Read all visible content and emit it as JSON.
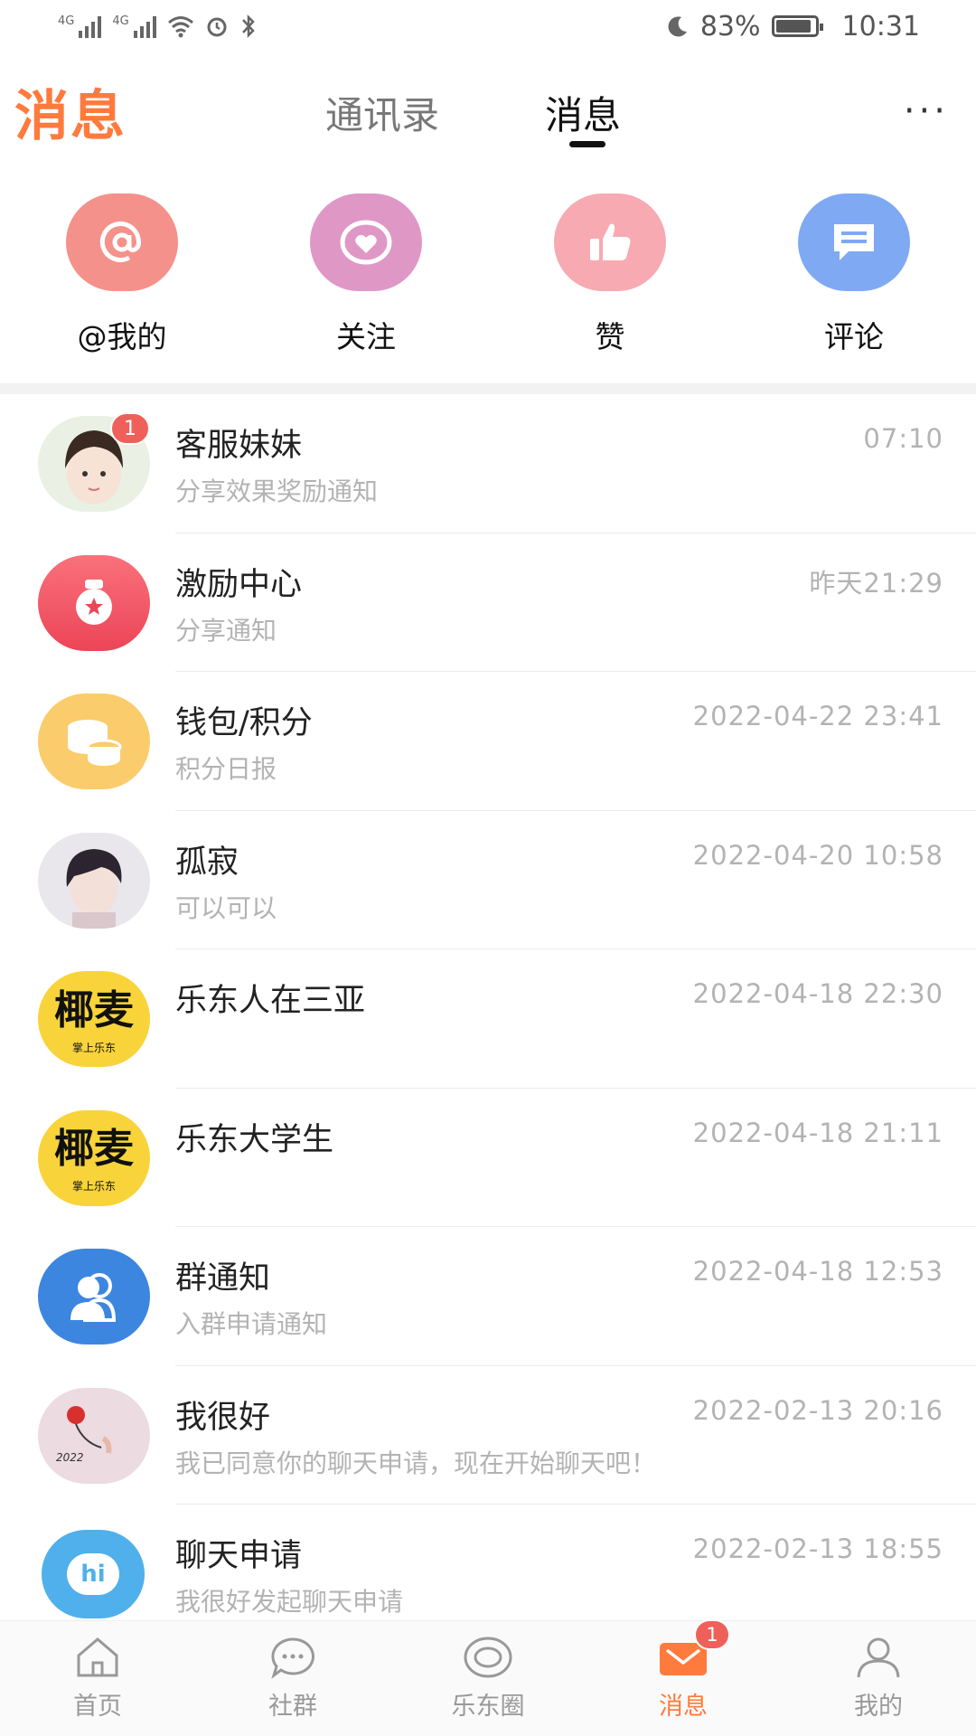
{
  "status_bar": {
    "net1": "4G",
    "net2": "4G",
    "battery": "83%",
    "time": "10:31"
  },
  "header": {
    "brand": "消息",
    "tabs": [
      "通讯录",
      "消息"
    ],
    "more": "···"
  },
  "quick_actions": [
    {
      "label": "@我的",
      "icon": "at-icon",
      "color": "#f4918a"
    },
    {
      "label": "关注",
      "icon": "heart-icon",
      "color": "#df98c6"
    },
    {
      "label": "赞",
      "icon": "thumbs-up-icon",
      "color": "#f7aab1"
    },
    {
      "label": "评论",
      "icon": "comment-icon",
      "color": "#7fa9f2"
    }
  ],
  "conversations": [
    {
      "name": "客服妹妹",
      "sub": "分享效果奖励通知",
      "time": "07:10",
      "badge": "1",
      "avatar": "girl-avatar"
    },
    {
      "name": "激励中心",
      "sub": "分享通知",
      "time": "昨天21:29",
      "avatar": "medal-icon"
    },
    {
      "name": "钱包/积分",
      "sub": "积分日报",
      "time": "2022-04-22 23:41",
      "avatar": "coins-icon"
    },
    {
      "name": "孤寂",
      "sub": "可以可以",
      "time": "2022-04-20 10:58",
      "avatar": "boy-avatar"
    },
    {
      "name": "乐东人在三亚",
      "sub": "",
      "time": "2022-04-18 22:30",
      "avatar": "yemai-logo",
      "logo_text": "椰麦",
      "logo_sub": "掌上乐东"
    },
    {
      "name": "乐东大学生",
      "sub": "",
      "time": "2022-04-18 21:11",
      "avatar": "yemai-logo",
      "logo_text": "椰麦",
      "logo_sub": "掌上乐东"
    },
    {
      "name": "群通知",
      "sub": "入群申请通知",
      "time": "2022-04-18 12:53",
      "avatar": "group-icon"
    },
    {
      "name": "我很好",
      "sub": "我已同意你的聊天申请，现在开始聊天吧！",
      "time": "2022-02-13 20:16",
      "avatar": "flower-avatar",
      "avatar_text": "2022"
    },
    {
      "name": "聊天申请",
      "sub": "我很好发起聊天申请",
      "time": "2022-02-13 18:55",
      "avatar": "hi-icon",
      "avatar_text": "hi"
    }
  ],
  "bottom_nav": [
    {
      "label": "首页",
      "icon": "home-icon"
    },
    {
      "label": "社群",
      "icon": "chat-bubble-icon"
    },
    {
      "label": "乐东圈",
      "icon": "circle-icon"
    },
    {
      "label": "消息",
      "icon": "mail-icon",
      "active": true,
      "badge": "1"
    },
    {
      "label": "我的",
      "icon": "profile-icon"
    }
  ],
  "accent_color": "#ff7a3d"
}
